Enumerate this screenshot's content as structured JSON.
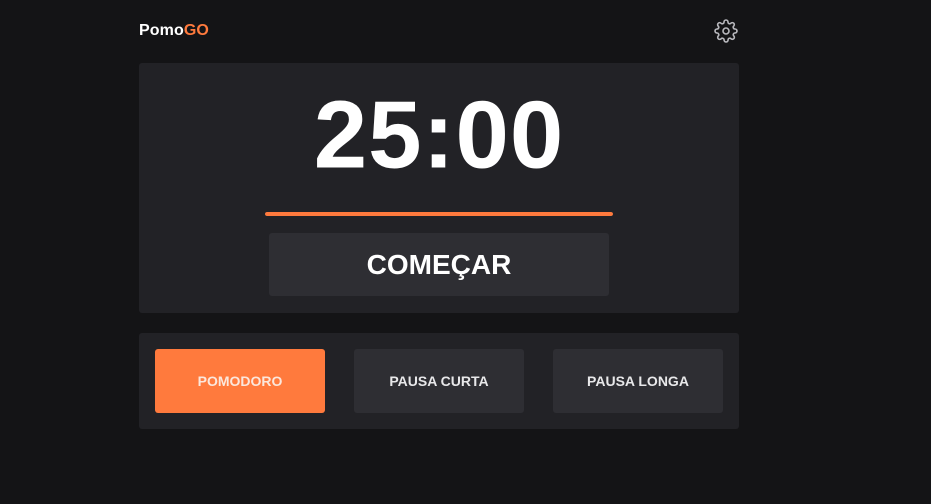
{
  "header": {
    "logo_prefix": "Pomo",
    "logo_suffix": "GO",
    "settings_icon": "gear-icon"
  },
  "timer": {
    "time": "25:00",
    "progress": 1.0,
    "start_label": "COMEÇAR"
  },
  "modes": [
    {
      "label": "POMODORO",
      "active": true
    },
    {
      "label": "PAUSA CURTA",
      "active": false
    },
    {
      "label": "PAUSA LONGA",
      "active": false
    }
  ],
  "colors": {
    "accent": "#ff7a3d",
    "background": "#141416",
    "card": "#222226",
    "button": "#2e2e33"
  }
}
